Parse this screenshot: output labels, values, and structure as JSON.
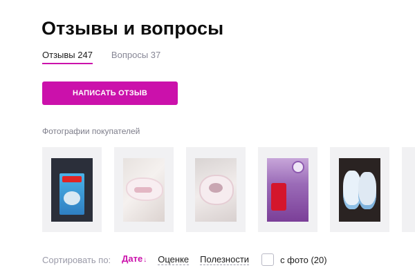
{
  "page": {
    "title": "Отзывы и вопросы"
  },
  "tabs": [
    {
      "label": "Отзывы 247",
      "active": true
    },
    {
      "label": "Вопросы 37",
      "active": false
    }
  ],
  "write_review_button": "НАПИСАТЬ ОТЗЫВ",
  "photos": {
    "title": "Фотографии покупателей",
    "items": [
      {
        "alt": "diaper-pack-photo"
      },
      {
        "alt": "diaper-photo"
      },
      {
        "alt": "diaper-photo"
      },
      {
        "alt": "huggies-pack-photo"
      },
      {
        "alt": "diapers-photo"
      }
    ]
  },
  "sort": {
    "label": "Сортировать по:",
    "options": [
      {
        "label": "Дате",
        "active": true,
        "arrow": "↓"
      },
      {
        "label": "Оценке",
        "active": false
      },
      {
        "label": "Полезности",
        "active": false
      }
    ],
    "with_photo": {
      "label": "с фото (20)",
      "checked": false
    }
  },
  "colors": {
    "accent": "#cb11ab",
    "muted": "#868695",
    "thumb_bg": "#f1f1f3"
  }
}
